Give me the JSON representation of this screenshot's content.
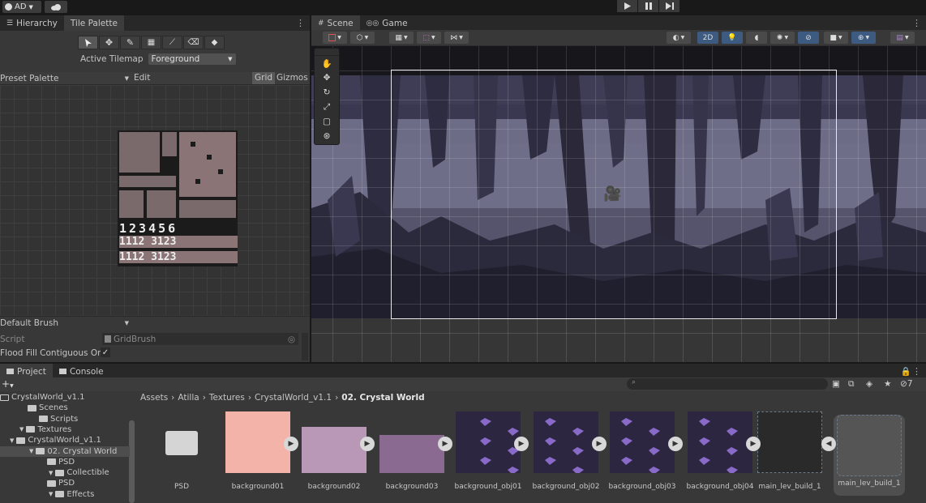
{
  "topbar": {
    "account_label": "AD"
  },
  "left_panel": {
    "tabs": [
      {
        "label": "Hierarchy"
      },
      {
        "label": "Tile Palette"
      }
    ],
    "active_tilemap_label": "Active Tilemap",
    "active_tilemap_value": "Foreground",
    "palette_select": "Preset Palette",
    "edit_label": "Edit",
    "grid_label": "Grid",
    "gizmos_label": "Gizmos",
    "brush_select": "Default Brush",
    "script_label": "Script",
    "script_value": "GridBrush",
    "flood_fill_label": "Flood Fill Contiguous Only",
    "tile_digits_row1": "123456",
    "tile_digits_row2": "1112 3123",
    "tile_digits_row3": "1112 3123"
  },
  "scene_panel": {
    "tabs": [
      {
        "label": "Scene"
      },
      {
        "label": "Game"
      }
    ],
    "mode_2d": "2D"
  },
  "bottom_panel": {
    "tabs": [
      {
        "label": "Project"
      },
      {
        "label": "Console"
      }
    ],
    "hidden_count": "7",
    "breadcrumb": [
      "Assets",
      "Atilla",
      "Textures",
      "CrystalWorld_v1.1",
      "02. Crystal World"
    ],
    "tree": [
      {
        "label": "CrystalWorld_v1.1",
        "indent": 1
      },
      {
        "label": "Scenes",
        "indent": 2
      },
      {
        "label": "Scripts",
        "indent": 2
      },
      {
        "label": "Textures",
        "indent": 1
      },
      {
        "label": "CrystalWorld_v1.1",
        "indent": 2
      },
      {
        "label": "02. Crystal World",
        "indent": 3
      },
      {
        "label": "PSD",
        "indent": 4
      },
      {
        "label": "Collectible",
        "indent": 3
      },
      {
        "label": "PSD",
        "indent": 4
      },
      {
        "label": "Effects",
        "indent": 3
      }
    ],
    "assets": [
      {
        "label": "PSD"
      },
      {
        "label": "background01"
      },
      {
        "label": "background02"
      },
      {
        "label": "background03"
      },
      {
        "label": "background_obj01"
      },
      {
        "label": "background_obj02"
      },
      {
        "label": "background_obj03"
      },
      {
        "label": "background_obj04"
      },
      {
        "label": "main_lev_build_1"
      },
      {
        "label": "main_lev_build_1"
      }
    ]
  }
}
